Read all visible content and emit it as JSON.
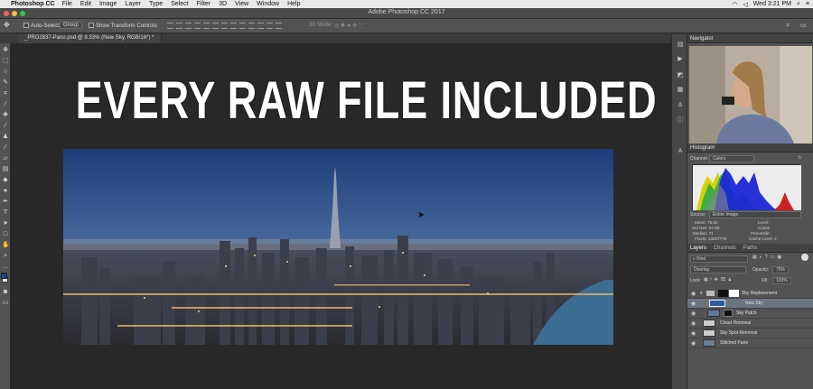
{
  "menubar": {
    "app": "Photoshop CC",
    "items": [
      "File",
      "Edit",
      "Image",
      "Layer",
      "Type",
      "Select",
      "Filter",
      "3D",
      "View",
      "Window",
      "Help"
    ],
    "clock": "Wed 3:21 PM"
  },
  "window": {
    "title": "Adobe Photoshop CC 2017"
  },
  "options": {
    "auto_select_label": "Auto-Select:",
    "auto_select_value": "Group",
    "transform_label": "Show Transform Controls",
    "mode_3d_label": "3D Mode:"
  },
  "document": {
    "tab": "_PRO2837-Pano.psd @ 8.33% (New Sky, RGB/16*) *"
  },
  "overlay": {
    "headline": "EVERY RAW FILE INCLUDED"
  },
  "panels": {
    "navigator": "Navigator",
    "histogram": "Histogram",
    "channel_label": "Channel:",
    "channel_value": "Colors",
    "source_label": "Source:",
    "source_value": "Entire Image",
    "stats": {
      "mean_label": "Mean:",
      "mean": "75.83",
      "stddev_label": "Std Dev:",
      "stddev": "57.80",
      "median_label": "Median:",
      "median": "71",
      "pixels_label": "Pixels:",
      "pixels": "13267776",
      "level_label": "Level:",
      "count_label": "Count:",
      "percentile_label": "Percentile:",
      "cache_label": "Cache Level:",
      "cache": "4"
    },
    "layer_tabs": [
      "Layers",
      "Channels",
      "Paths"
    ],
    "kind": "Kind",
    "blend": "Overlay",
    "opacity_label": "Opacity:",
    "opacity": "75%",
    "lock_label": "Lock:",
    "fill_label": "Fill:",
    "fill": "100%",
    "layers": [
      "Sky Replacement",
      "New Sky",
      "Sky Patch",
      "Cloud Removal",
      "Sky Spot Removal",
      "Stitched Pano"
    ]
  },
  "colors": {
    "accent": "#2f6fb3",
    "photo_sky_top": "#1d3d7a",
    "photo_sky_bottom": "#7a95b5"
  }
}
